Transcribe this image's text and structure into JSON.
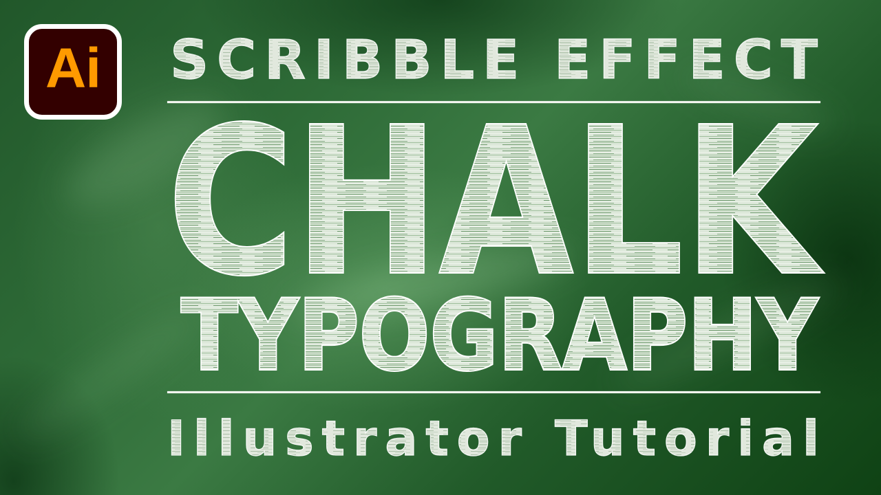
{
  "logo": {
    "text": "Ai",
    "name": "adobe-illustrator-logo",
    "colors": {
      "border": "#ffffff",
      "background": "#330000",
      "text": "#ff9a00"
    }
  },
  "headline": {
    "top_line": "SCRIBBLE EFFECT",
    "main_line": "CHALK",
    "second_line": "TYPOGRAPHY",
    "bottom_line": "Illustrator Tutorial"
  },
  "colors": {
    "chalkboard": "#2e6b37",
    "chalk": "#ffffff",
    "chalk_hatch": "#dfe9dc"
  }
}
